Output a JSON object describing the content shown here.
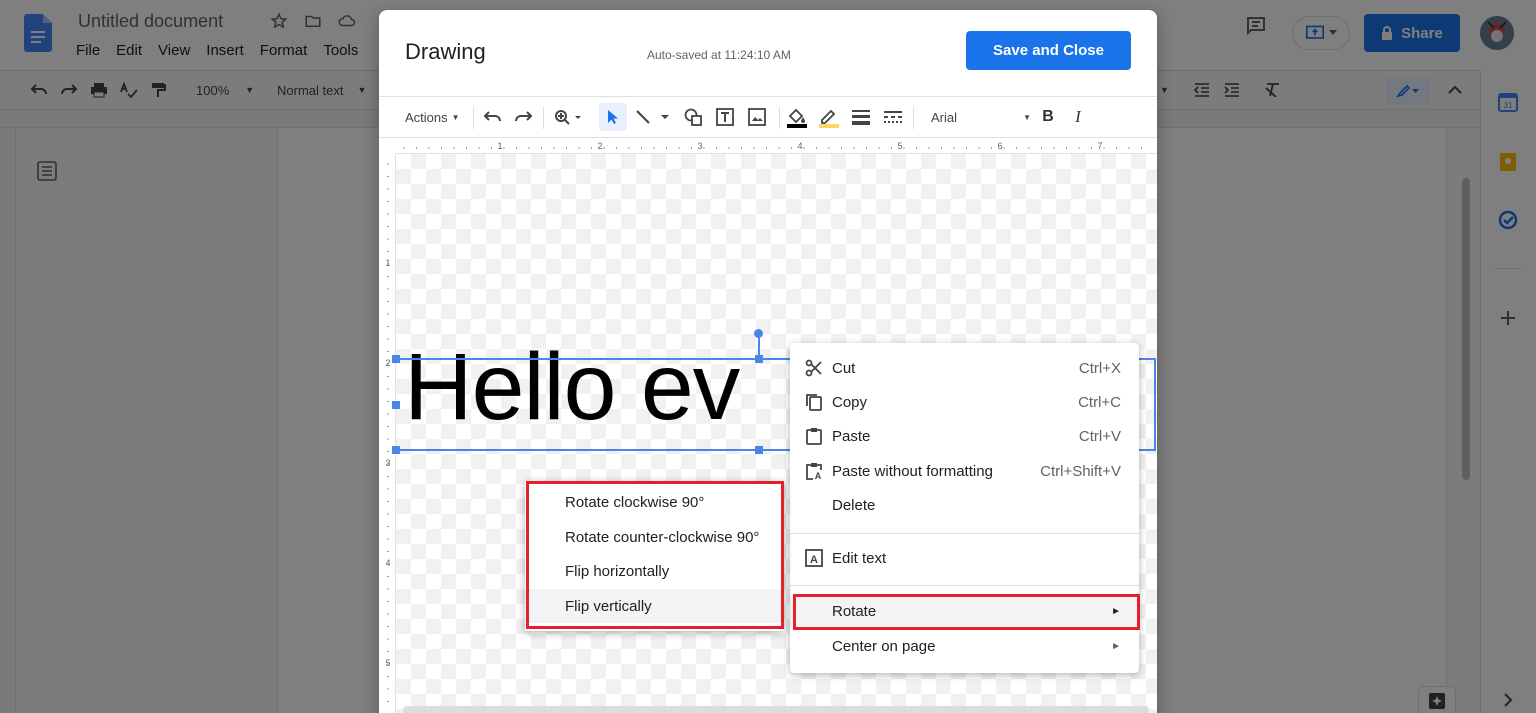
{
  "docs": {
    "title": "Untitled document",
    "menu": [
      "File",
      "Edit",
      "View",
      "Insert",
      "Format",
      "Tools"
    ],
    "toolbar": {
      "zoom": "100%",
      "style": "Normal text"
    },
    "share_label": "Share"
  },
  "dialog": {
    "title": "Drawing",
    "autosave": "Auto-saved at 11:24:10 AM",
    "save_close": "Save and Close",
    "toolbar": {
      "actions": "Actions",
      "font": "Arial"
    },
    "h_ruler_numbers": [
      "1",
      "2",
      "3",
      "4",
      "5",
      "6",
      "7"
    ],
    "v_ruler_numbers": [
      "1",
      "2",
      "3",
      "4",
      "5"
    ],
    "canvas_text": "Hello ev"
  },
  "context_menu": {
    "items": [
      {
        "label": "Cut",
        "shortcut": "Ctrl+X",
        "icon": "scissors-icon"
      },
      {
        "label": "Copy",
        "shortcut": "Ctrl+C",
        "icon": "copy-icon"
      },
      {
        "label": "Paste",
        "shortcut": "Ctrl+V",
        "icon": "clipboard-icon"
      },
      {
        "label": "Paste without formatting",
        "shortcut": "Ctrl+Shift+V",
        "icon": "paste-plain-icon"
      },
      {
        "label": "Delete",
        "shortcut": ""
      }
    ],
    "edit_text": "Edit text",
    "rotate": "Rotate",
    "center": "Center on page"
  },
  "rotate_submenu": [
    "Rotate clockwise 90°",
    "Rotate counter-clockwise 90°",
    "Flip horizontally",
    "Flip vertically"
  ],
  "colors": {
    "accent": "#1a73e8",
    "highlight": "#e5202a",
    "selection": "#4a86e8"
  }
}
